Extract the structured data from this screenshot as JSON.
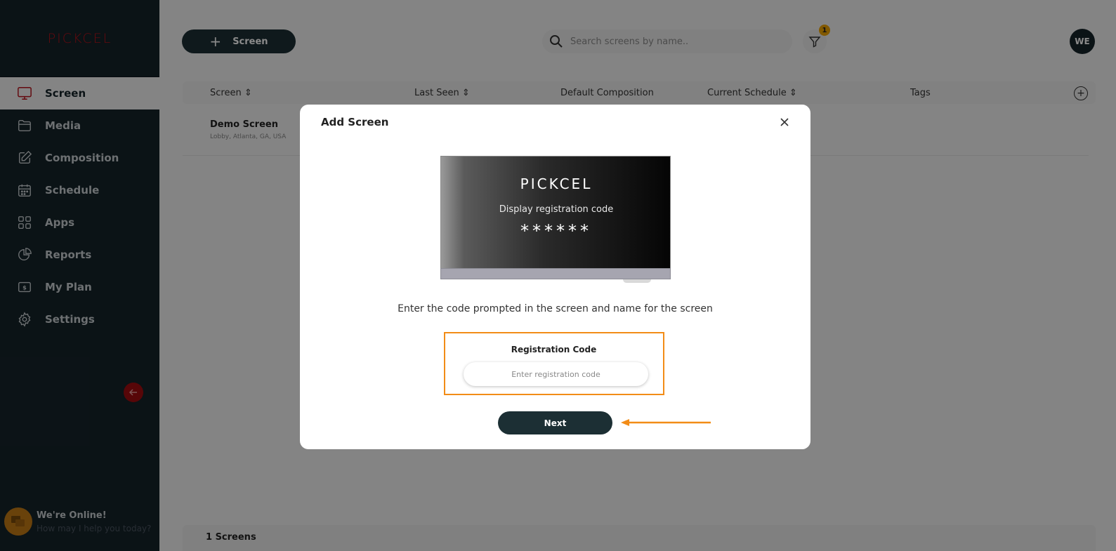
{
  "sidebar": {
    "logo": "PICKCEL",
    "items": [
      {
        "label": "Screen",
        "icon": "monitor-icon",
        "active": true
      },
      {
        "label": "Media",
        "icon": "folder-icon",
        "active": false
      },
      {
        "label": "Composition",
        "icon": "edit-icon",
        "active": false
      },
      {
        "label": "Schedule",
        "icon": "calendar-icon",
        "active": false
      },
      {
        "label": "Apps",
        "icon": "apps-grid-icon",
        "active": false
      },
      {
        "label": "Reports",
        "icon": "pie-chart-icon",
        "active": false
      },
      {
        "label": "My Plan",
        "icon": "billing-icon",
        "active": false
      },
      {
        "label": "Settings",
        "icon": "gear-icon",
        "active": false
      }
    ],
    "chat_title": "We're Online!",
    "chat_subtitle": "How may I help you today?"
  },
  "header": {
    "add_button_label": "Screen",
    "search_placeholder": "Search screens by name..",
    "filter_count": "1",
    "avatar_initials": "WE"
  },
  "table": {
    "columns": [
      "Screen",
      "Last Seen",
      "Default Composition",
      "Current Schedule",
      "Tags"
    ],
    "rows": [
      {
        "name": "Demo Screen",
        "location": "Lobby, Atlanta, GA, USA"
      }
    ],
    "footer_count": "1 Screens"
  },
  "modal": {
    "title": "Add Screen",
    "tv_logo": "PICKCEL",
    "tv_label": "Display registration code",
    "tv_code": "******",
    "instruction": "Enter the code prompted in the screen and name for the screen",
    "code_label": "Registration Code",
    "code_placeholder": "Enter registration code",
    "code_value": "",
    "next_label": "Next"
  },
  "colors": {
    "sidebar_bg": "#16232a",
    "brand_red": "#b8121a",
    "primary_button": "#1c2f34",
    "highlight_orange": "#f28c17",
    "badge": "#f0a500"
  }
}
